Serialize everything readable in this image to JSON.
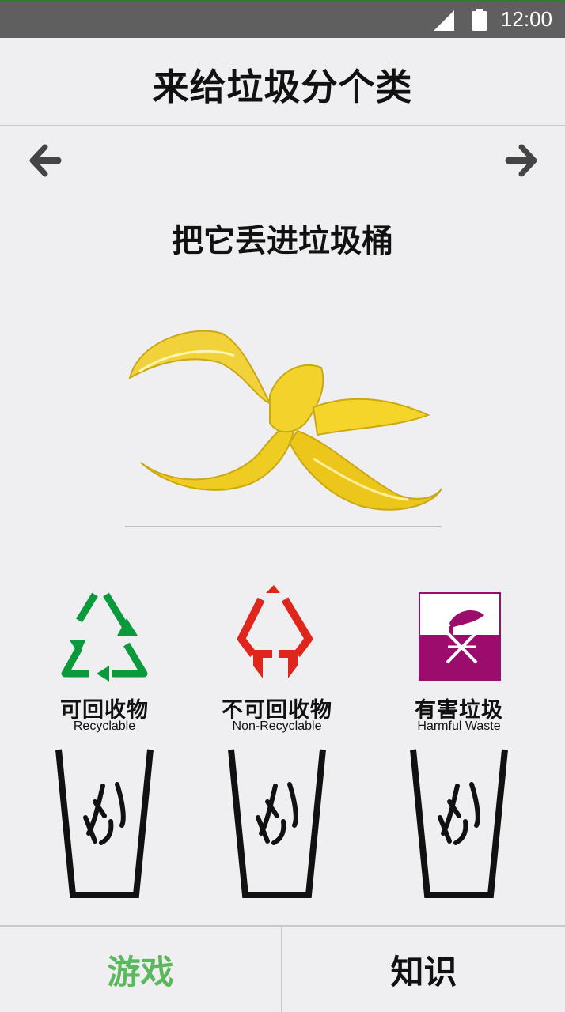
{
  "status_bar": {
    "time": "12:00",
    "icons": [
      "signal-icon",
      "battery-icon"
    ]
  },
  "header": {
    "title": "来给垃圾分个类"
  },
  "navigation": {
    "prev_icon": "arrow-left-icon",
    "next_icon": "arrow-right-icon"
  },
  "main": {
    "prompt": "把它丢进垃圾桶",
    "item_icon": "banana-peel-image"
  },
  "bins": [
    {
      "label_cn": "可回收物",
      "label_en": "Recyclable",
      "color": "#0a9a3c",
      "icon": "recycle-icon"
    },
    {
      "label_cn": "不可回收物",
      "label_en": "Non-Recyclable",
      "color": "#e0261c",
      "icon": "non-recycle-icon"
    },
    {
      "label_cn": "有害垃圾",
      "label_en": "Harmful Waste",
      "color": "#9c0c6c",
      "icon": "harmful-waste-icon"
    }
  ],
  "tabs": [
    {
      "label": "游戏",
      "active": true,
      "color": "#5cb85c"
    },
    {
      "label": "知识",
      "active": false,
      "color": "#111111"
    }
  ]
}
